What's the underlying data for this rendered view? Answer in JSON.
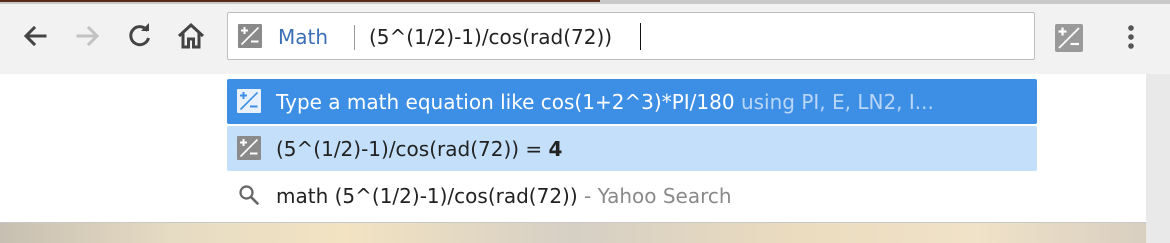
{
  "toolbar": {
    "back_label": "Back",
    "forward_label": "Forward",
    "reload_label": "Reload",
    "home_label": "Home"
  },
  "omnibox": {
    "keyword": "Math",
    "query": "(5^(1/2)-1)/cos(rad(72))"
  },
  "suggestions": [
    {
      "icon": "math-icon",
      "text": "Type a math equation like cos(1+2^3)*PI/180",
      "hint": " using PI, E, LN2, I..."
    },
    {
      "icon": "math-icon",
      "expression": "(5^(1/2)-1)/cos(rad(72)) = ",
      "result": "4"
    },
    {
      "icon": "search-icon",
      "text": "math (5^(1/2)-1)/cos(rad(72))",
      "source": " - Yahoo Search"
    }
  ],
  "colors": {
    "highlight": "#3d8fe6",
    "selected_row": "#c3dff9",
    "keyword": "#3b6fb6"
  }
}
